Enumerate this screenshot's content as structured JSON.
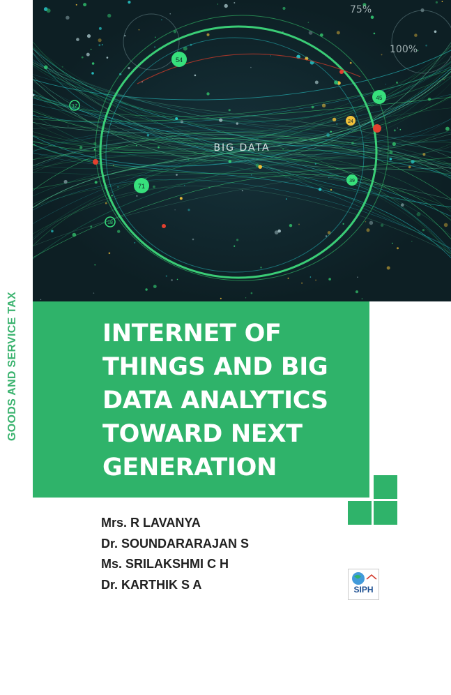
{
  "cover_image": {
    "center_label": "BIG DATA",
    "pct_top": "75%",
    "pct_mid": "100%",
    "node_labels": [
      "54",
      "17",
      "45",
      "24",
      "71",
      "18",
      "39"
    ],
    "colors": {
      "background": "#0f2328",
      "ring": "#3fe07e",
      "node_green": "#37e07c",
      "node_red": "#e3402f",
      "node_yellow": "#f0c03a",
      "node_cyan": "#27c6c8"
    }
  },
  "side_label": "GOODS AND SERVICE TAX",
  "title_lines": [
    "INTERNET OF",
    "THINGS AND BIG",
    "DATA ANALYTICS",
    "TOWARD NEXT",
    "GENERATION"
  ],
  "authors": [
    "Mrs. R LAVANYA",
    "Dr. SOUNDARARAJAN S",
    "Ms. SRILAKSHMI C H",
    "Dr. KARTHIK S A"
  ],
  "publisher_logo_text": "SIPH",
  "colors": {
    "accent_green": "#2fb36a",
    "side_text_green": "#3bb36f",
    "author_text": "#202020"
  }
}
